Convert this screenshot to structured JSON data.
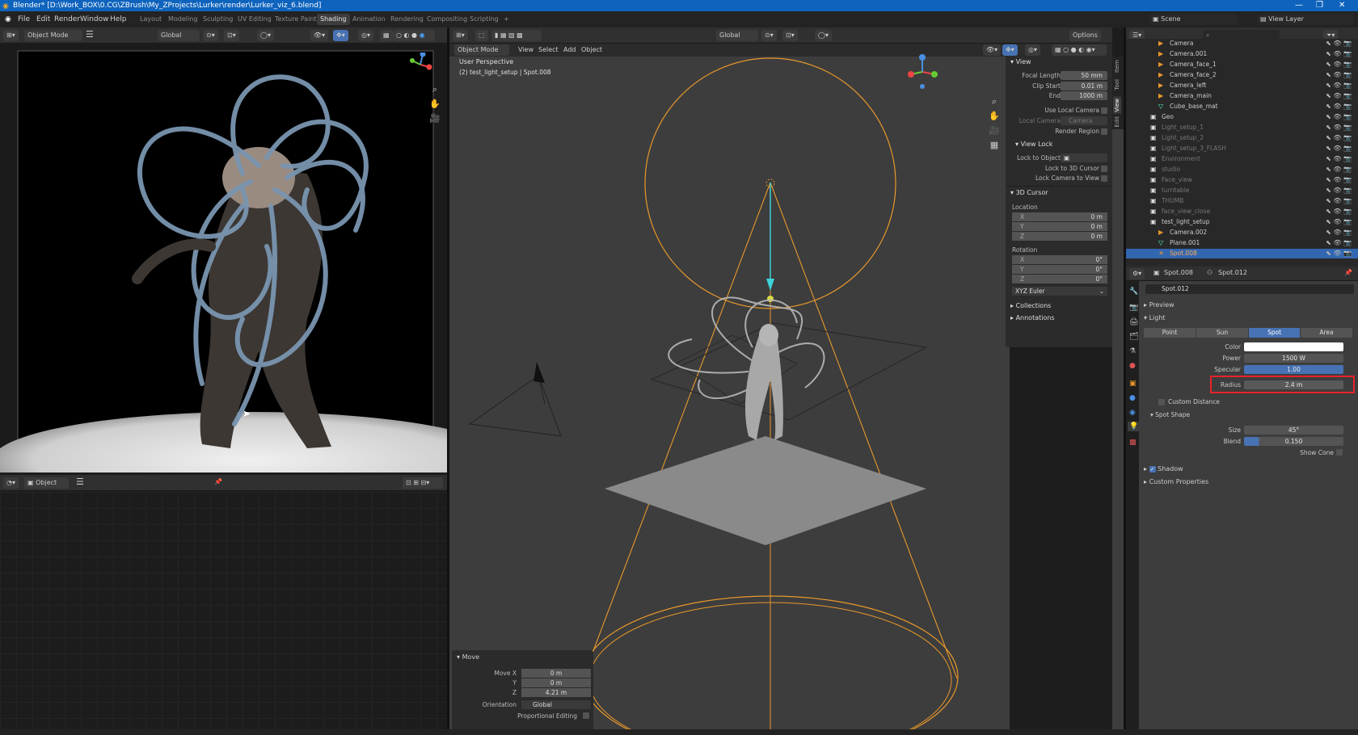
{
  "window": {
    "title": "Blender* [D:\\Work_BOX\\0.CG\\ZBrush\\My_ZProjects\\Lurker\\render\\Lurker_viz_6.blend]",
    "controls": [
      "—",
      "❐",
      "✕"
    ]
  },
  "menu": [
    "File",
    "Edit",
    "Render",
    "Window",
    "Help"
  ],
  "workspaces": [
    "Layout",
    "Modeling",
    "Sculpting",
    "UV Editing",
    "Texture Paint",
    "Shading",
    "Animation",
    "Rendering",
    "Compositing",
    "Scripting",
    "+"
  ],
  "active_workspace": "Shading",
  "top_right": {
    "scene": "Scene",
    "view_layer": "View Layer"
  },
  "left_viewport": {
    "mode": "Object Mode",
    "orientation": "Global"
  },
  "node_editor": {
    "type": "Object"
  },
  "main_viewport": {
    "mode": "Object Mode",
    "menus": [
      "View",
      "Select",
      "Add",
      "Object"
    ],
    "orientation": "Global",
    "options": "Options",
    "perspective_label": "User Perspective",
    "object_label": "(2) test_light_setup | Spot.008"
  },
  "npanel": {
    "tabs": [
      "Item",
      "Tool",
      "View",
      "Edit"
    ],
    "view_header": "View",
    "focal_length_label": "Focal Length",
    "focal_length": "50 mm",
    "clip_start_label": "Clip Start",
    "clip_start": "0.01 m",
    "end_label": "End",
    "end": "1000 m",
    "use_local_camera": "Use Local Camera",
    "local_camera_label": "Local Camera",
    "local_camera": "Camera",
    "render_region": "Render Region",
    "view_lock_header": "View Lock",
    "lock_to_object": "Lock to Object",
    "lock_to_3d_cursor": "Lock to 3D Cursor",
    "lock_camera_to_view": "Lock Camera to View",
    "cursor_header": "3D Cursor",
    "location_label": "Location",
    "loc": [
      {
        "axis": "X",
        "value": "0 m"
      },
      {
        "axis": "Y",
        "value": "0 m"
      },
      {
        "axis": "Z",
        "value": "0 m"
      }
    ],
    "rotation_label": "Rotation",
    "rot": [
      {
        "axis": "X",
        "value": "0°"
      },
      {
        "axis": "Y",
        "value": "0°"
      },
      {
        "axis": "Z",
        "value": "0°"
      }
    ],
    "rotation_mode": "XYZ Euler",
    "collections": "Collections",
    "annotations": "Annotations"
  },
  "operator_panel": {
    "title": "Move",
    "move_x_label": "Move X",
    "move_x": "0 m",
    "y_label": "Y",
    "y": "0 m",
    "z_label": "Z",
    "z": "4.21 m",
    "orientation_label": "Orientation",
    "orientation": "Global",
    "proportional_label": "Proportional Editing"
  },
  "outliner": {
    "items": [
      {
        "name": "Camera",
        "type": "camera",
        "dim": false
      },
      {
        "name": "Camera.001",
        "type": "camera",
        "dim": false
      },
      {
        "name": "Camera_face_1",
        "type": "camera",
        "dim": false
      },
      {
        "name": "Camera_face_2",
        "type": "camera",
        "dim": false
      },
      {
        "name": "Camera_left",
        "type": "camera",
        "dim": false
      },
      {
        "name": "Camera_main",
        "type": "camera",
        "dim": false
      },
      {
        "name": "Cube_base_mat",
        "type": "mesh",
        "dim": false
      },
      {
        "name": "Geo",
        "type": "collection",
        "dim": false
      },
      {
        "name": "Light_setup_1",
        "type": "collection",
        "dim": true
      },
      {
        "name": "Light_setup_2",
        "type": "collection",
        "dim": true
      },
      {
        "name": "Light_setup_3_FLASH",
        "type": "collection",
        "dim": true
      },
      {
        "name": "Environment",
        "type": "collection",
        "dim": true
      },
      {
        "name": "studio",
        "type": "collection",
        "dim": true
      },
      {
        "name": "Face_view",
        "type": "collection",
        "dim": true
      },
      {
        "name": "turntable",
        "type": "collection",
        "dim": true
      },
      {
        "name": "THUMB",
        "type": "collection",
        "dim": true
      },
      {
        "name": "face_view_close",
        "type": "collection",
        "dim": true
      },
      {
        "name": "test_light_setup",
        "type": "collection",
        "dim": false
      },
      {
        "name": "Camera.002",
        "type": "camera",
        "dim": false
      },
      {
        "name": "Plane.001",
        "type": "mesh",
        "dim": false
      },
      {
        "name": "Spot.008",
        "type": "light",
        "dim": false,
        "selected": true
      }
    ]
  },
  "properties": {
    "breadcrumb_object": "Spot.008",
    "breadcrumb_data": "Spot.012",
    "datablock": "Spot.012",
    "preview": "Preview",
    "light": "Light",
    "light_types": [
      "Point",
      "Sun",
      "Spot",
      "Area"
    ],
    "active_light_type": "Spot",
    "color_label": "Color",
    "power_label": "Power",
    "power": "1500 W",
    "specular_label": "Specular",
    "specular": "1.00",
    "radius_label": "Radius",
    "radius": "2.4 m",
    "custom_distance": "Custom Distance",
    "spot_shape": "Spot Shape",
    "size_label": "Size",
    "size": "45°",
    "blend_label": "Blend",
    "blend": "0.150",
    "show_cone": "Show Cone",
    "shadow": "Shadow",
    "custom_properties": "Custom Properties"
  },
  "colors": {
    "accent": "#4772b3",
    "selection": "#3266b1",
    "highlight": "#e8222b",
    "light_wire": "#e8982b",
    "cone_axis": "#3fd2d9"
  }
}
